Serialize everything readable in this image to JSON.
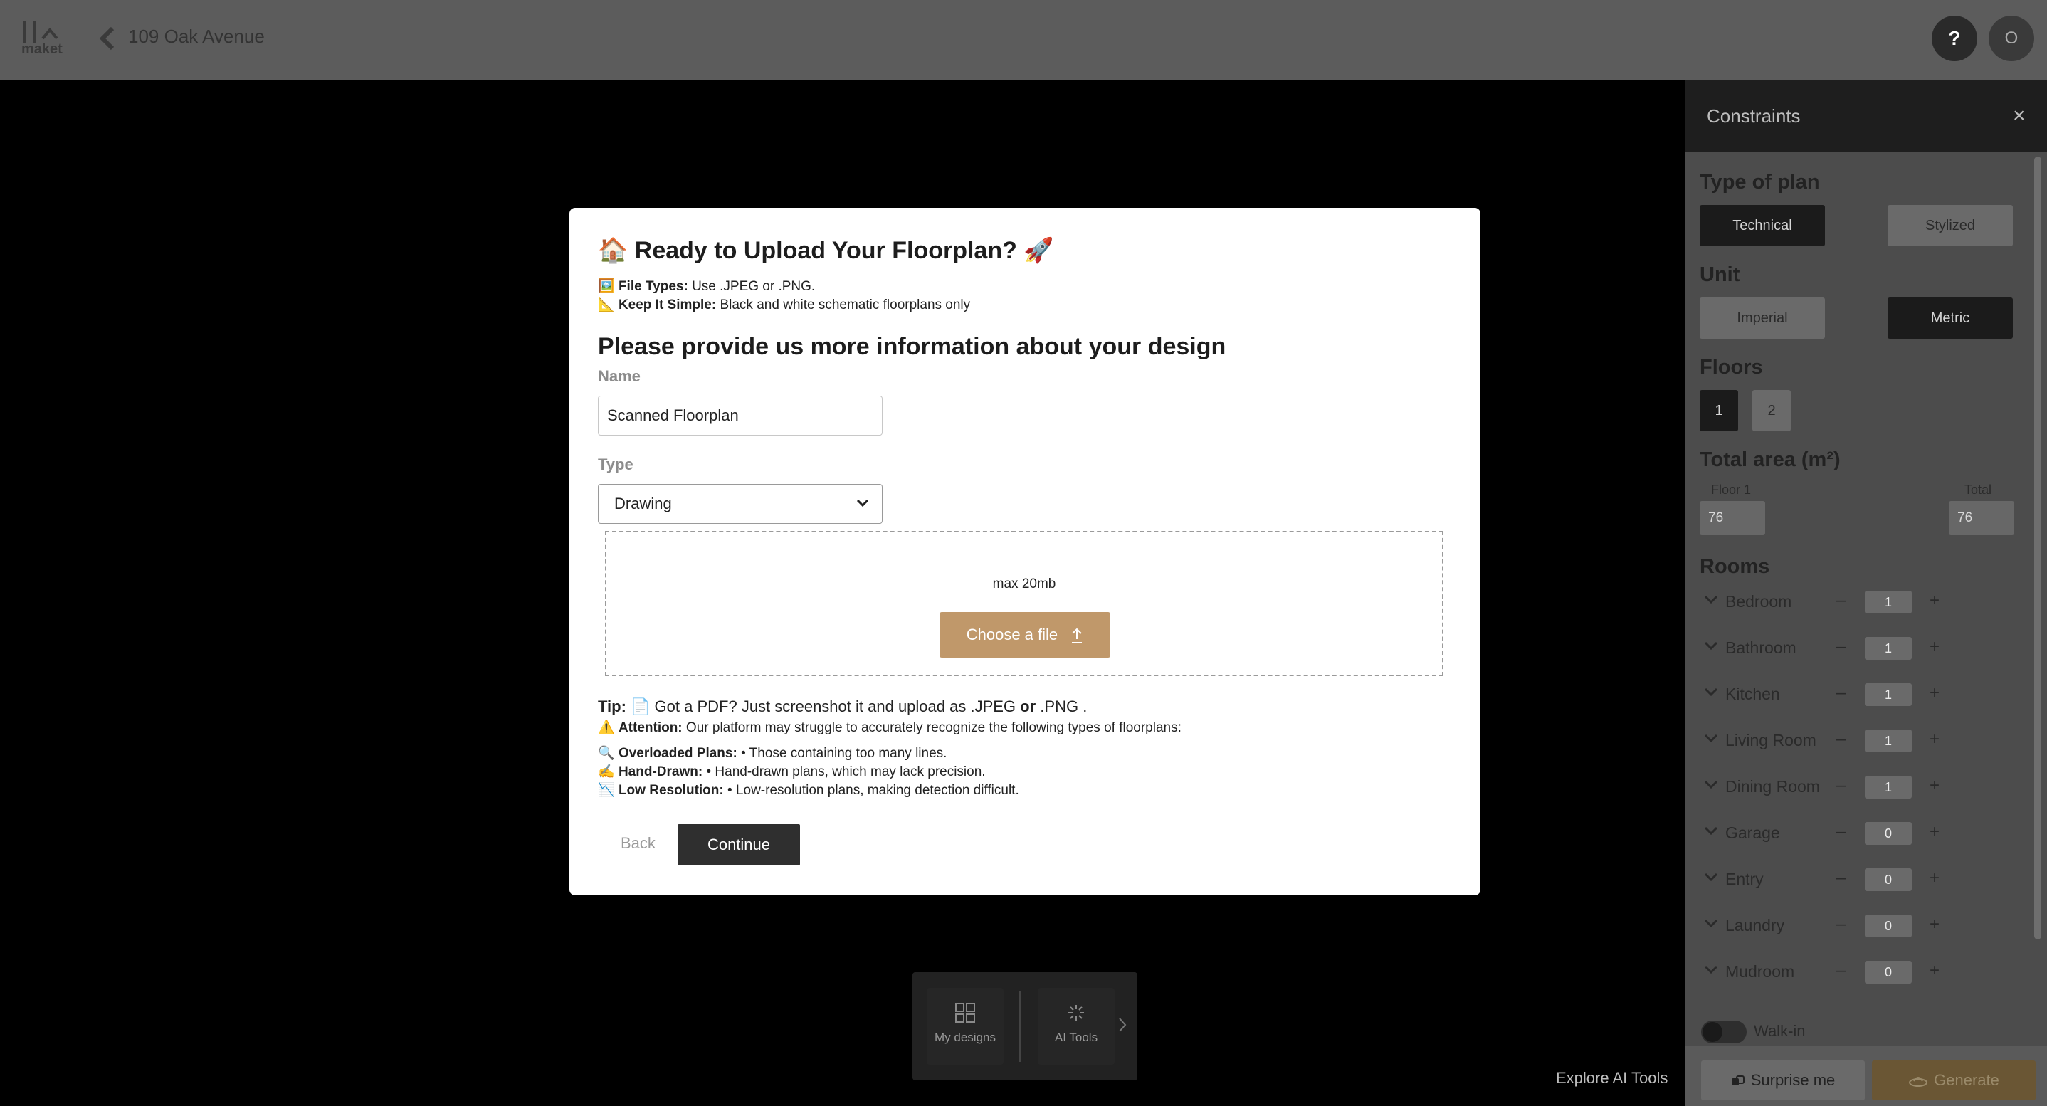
{
  "topbar": {
    "logo_text": "maket",
    "project_title": "109 Oak Avenue",
    "help_label": "?",
    "avatar_initial": "O"
  },
  "modal": {
    "title": "🏠 Ready to Upload Your Floorplan? 🚀",
    "file_types_label": "File Types:",
    "file_types_text": "Use .JPEG or .PNG.",
    "keep_simple_label": "Keep It Simple:",
    "keep_simple_text": "Black and white schematic floorplans only",
    "info_heading": "Please provide us more information about your design",
    "name_label": "Name",
    "name_value": "Scanned Floorplan",
    "type_label": "Type",
    "type_value": "Drawing",
    "max_size": "max 20mb",
    "choose_file": "Choose a file",
    "tip_label": "Tip:",
    "tip_text_1": "📄 Got a PDF? Just screenshot it and upload as .JPEG",
    "tip_or": "or",
    "tip_text_2": ".PNG .",
    "attention_label": "Attention:",
    "attention_text": "Our platform may struggle to accurately recognize the following types of floorplans:",
    "issues": [
      {
        "icon": "🔍",
        "label": "Overloaded Plans:",
        "text": "• Those containing too many lines."
      },
      {
        "icon": "✍️",
        "label": "Hand-Drawn:",
        "text": "• Hand-drawn plans, which may lack precision."
      },
      {
        "icon": "📉",
        "label": "Low Resolution:",
        "text": "• Low-resolution plans, making detection difficult."
      }
    ],
    "back_label": "Back",
    "continue_label": "Continue"
  },
  "dock": {
    "items": [
      {
        "label": "My designs",
        "icon": "grid-icon"
      },
      {
        "label": "AI Tools",
        "icon": "sparkle-icon"
      }
    ],
    "explore_label": "Explore AI Tools"
  },
  "panel": {
    "title": "Constraints",
    "close_label": "×",
    "plan_type": {
      "title": "Type of plan",
      "options": [
        "Technical",
        "Stylized"
      ],
      "selected": "Technical"
    },
    "unit": {
      "title": "Unit",
      "options": [
        "Imperial",
        "Metric"
      ],
      "selected": "Metric"
    },
    "floors": {
      "title": "Floors",
      "options": [
        "1",
        "2"
      ],
      "selected": "1"
    },
    "total_area": {
      "title": "Total area (m²)",
      "floor1_label": "Floor 1",
      "floor1_value": "76",
      "total_label": "Total",
      "total_value": "76"
    },
    "rooms_title": "Rooms",
    "rooms": [
      {
        "name": "Bedroom",
        "count": "1"
      },
      {
        "name": "Bathroom",
        "count": "1"
      },
      {
        "name": "Kitchen",
        "count": "1"
      },
      {
        "name": "Living Room",
        "count": "1"
      },
      {
        "name": "Dining Room",
        "count": "1"
      },
      {
        "name": "Garage",
        "count": "0"
      },
      {
        "name": "Entry",
        "count": "0"
      },
      {
        "name": "Laundry",
        "count": "0"
      },
      {
        "name": "Mudroom",
        "count": "0"
      }
    ],
    "walkin_label": "Walk-in",
    "surprise_label": "Surprise me",
    "generate_label": "Generate"
  },
  "colors": {
    "accent": "#c0986a",
    "topbar": "#5c5c5c",
    "panel": "#4c4c4c"
  }
}
